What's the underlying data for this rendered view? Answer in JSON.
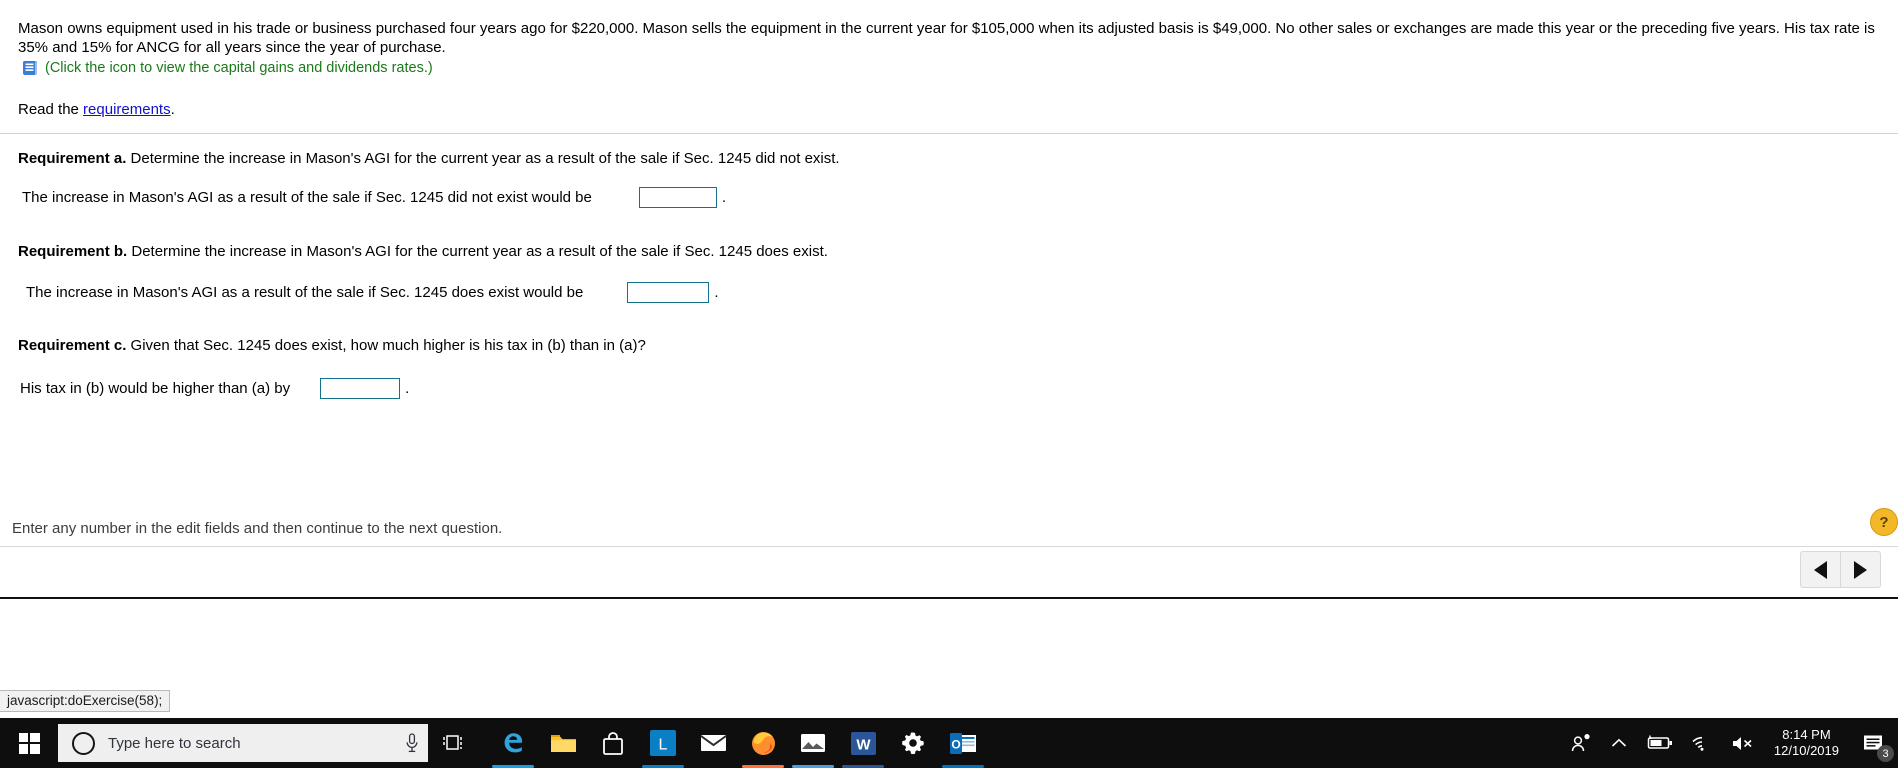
{
  "exercise": {
    "prompt": "Mason owns equipment used in his trade or business purchased four years ago for $220,000. Mason sells the equipment in the current year for $105,000 when its adjusted basis is $49,000. No other sales or exchanges are made this year or the preceding five years. His tax rate is 35% and 15% for ANCG for all years since the year of purchase.",
    "icon_caption": "(Click the icon to view the capital gains and dividends rates.)",
    "icon_name": "table-book-icon",
    "read_prefix": "Read the ",
    "read_link": "requirements",
    "read_suffix": ".",
    "requirements": [
      {
        "label": "Requirement a.",
        "text": " Determine the increase in Mason's AGI for the current year as a result of the sale if Sec. 1245 did not exist.",
        "answer_label": "The increase in Mason's AGI as a result of the sale if Sec. 1245 did not exist would be",
        "answer_value": "",
        "trailing": "."
      },
      {
        "label": "Requirement b.",
        "text": " Determine the increase in Mason's AGI for the current year as a result of the sale if Sec. 1245 does exist.",
        "answer_label": "The increase in Mason's AGI as a result of the sale if Sec. 1245 does exist would be",
        "answer_value": "",
        "trailing": "."
      },
      {
        "label": "Requirement c.",
        "text": " Given that Sec. 1245 does exist, how much higher is his tax in (b) than in (a)?",
        "answer_label": "His tax in (b) would be higher than (a) by",
        "answer_value": "",
        "trailing": "."
      }
    ],
    "status_text": "Enter any number in the edit fields and then continue to the next question.",
    "help_badge": "?",
    "nav_prev": "◀",
    "nav_next": "▶",
    "browser_status": "javascript:doExercise(58);"
  },
  "colors": {
    "link": "#1111cc",
    "icon_caption": "#1a7a1a",
    "field_border": "#13718c",
    "taskbar_bg": "#0e0e0e"
  },
  "taskbar": {
    "start_name": "start-button",
    "search_placeholder": "Type here to search",
    "search_value": "",
    "cortana_name": "cortana-circle-icon",
    "mic_name": "microphone-icon",
    "taskview_name": "task-view-icon",
    "apps": [
      {
        "name": "edge",
        "label": "e",
        "accent": "#1b9de2",
        "active": true
      },
      {
        "name": "file-explorer",
        "label": "",
        "accent": "#ffb900",
        "active": false
      },
      {
        "name": "microsoft-store",
        "label": "",
        "accent": "#4a4a4a",
        "active": false
      },
      {
        "name": "pearson-l",
        "label": "L",
        "accent": "#0b7fc6",
        "active": true
      },
      {
        "name": "mail",
        "label": "",
        "accent": "#4a4a4a",
        "active": false
      },
      {
        "name": "firefox",
        "label": "",
        "accent": "#ff7139",
        "active": true
      },
      {
        "name": "photos",
        "label": "",
        "accent": "#4a9fe0",
        "active": true
      },
      {
        "name": "word",
        "label": "W",
        "accent": "#2b579a",
        "active": true
      },
      {
        "name": "settings",
        "label": "",
        "accent": "#4a4a4a",
        "active": false
      },
      {
        "name": "outlook",
        "label": "",
        "accent": "#0072c6",
        "active": true
      }
    ],
    "tray": {
      "people_icon": "people-icon",
      "chevron_icon": "show-hidden-icons-chevron",
      "battery_icon": "battery-charging-icon",
      "network_icon": "wifi-icon",
      "volume_icon": "volume-muted-icon",
      "time": "8:14 PM",
      "date": "12/10/2019",
      "notifications_icon": "action-center-icon",
      "notifications_count": "3"
    }
  }
}
